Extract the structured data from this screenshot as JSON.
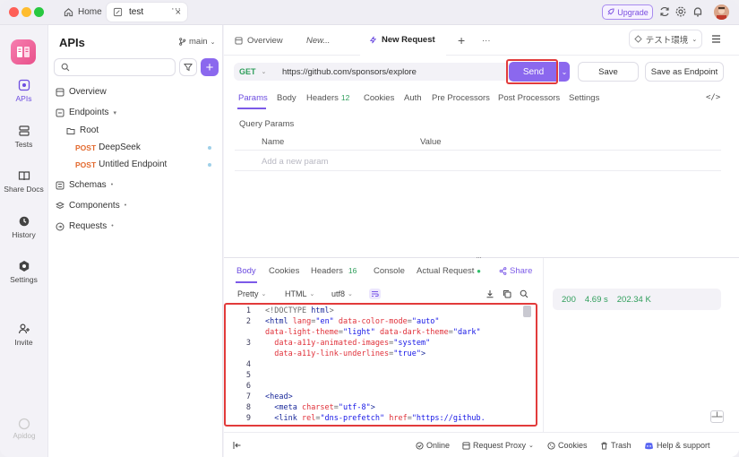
{
  "titlebar": {
    "tabs": [
      {
        "label": "Home"
      },
      {
        "label": "test"
      }
    ],
    "more": "···",
    "upgrade_label": "Upgrade"
  },
  "rail": {
    "items": [
      {
        "label": "APIs"
      },
      {
        "label": "Tests"
      },
      {
        "label": "Share Docs"
      },
      {
        "label": "History"
      },
      {
        "label": "Settings"
      },
      {
        "label": "Invite"
      }
    ],
    "footer": "Apidog"
  },
  "sidebar": {
    "title": "APIs",
    "branch": "main",
    "search_placeholder": "",
    "tree": {
      "overview": "Overview",
      "endpoints": "Endpoints",
      "root": "Root",
      "endpoints_list": [
        {
          "method": "POST",
          "name": "DeepSeek"
        },
        {
          "method": "POST",
          "name": "Untitled Endpoint"
        }
      ],
      "schemas": "Schemas",
      "components": "Components",
      "requests": "Requests"
    }
  },
  "request_tabs": {
    "tabs": [
      {
        "label": "Overview"
      },
      {
        "label": "New..."
      },
      {
        "label": "New Request"
      }
    ],
    "add": "+",
    "more": "···",
    "environment": "テスト環境"
  },
  "request": {
    "method": "GET",
    "url": "https://github.com/sponsors/explore",
    "send_label": "Send",
    "save_label": "Save",
    "save_endpoint_label": "Save as Endpoint",
    "method_color": "#2f9e5b",
    "accent": "#8b68ee"
  },
  "param_tabs": {
    "tabs": [
      {
        "label": "Params"
      },
      {
        "label": "Body"
      },
      {
        "label": "Headers",
        "count": "12"
      },
      {
        "label": "Cookies"
      },
      {
        "label": "Auth"
      },
      {
        "label": "Pre Processors"
      },
      {
        "label": "Post Processors"
      },
      {
        "label": "Settings"
      }
    ],
    "active": "Params",
    "code_icon": "</>"
  },
  "query_params": {
    "title": "Query Params",
    "columns": [
      "Name",
      "Value"
    ],
    "add_placeholder": "Add a new param"
  },
  "response": {
    "grip": "···",
    "tabs": [
      {
        "label": "Body"
      },
      {
        "label": "Cookies"
      },
      {
        "label": "Headers",
        "count": "16"
      },
      {
        "label": "Console"
      },
      {
        "label": "Actual Request"
      }
    ],
    "share_label": "Share",
    "format": {
      "view": "Pretty",
      "language": "HTML",
      "encoding": "utf8"
    },
    "stats": {
      "status": "200",
      "time": "4.69 s",
      "size": "202.34 K"
    },
    "lines": [
      {
        "num": "1",
        "segments": [
          {
            "t": "<!DOCTYPE ",
            "c": "cm"
          },
          {
            "t": "html",
            "c": "tag"
          },
          {
            "t": ">",
            "c": "cm"
          }
        ]
      },
      {
        "num": "2",
        "segments": [
          {
            "t": "<html ",
            "c": "tag"
          },
          {
            "t": "lang",
            "c": "at"
          },
          {
            "t": "=",
            "c": "cm"
          },
          {
            "t": "\"en\"",
            "c": "vl"
          },
          {
            "t": " data-color-mode",
            "c": "at"
          },
          {
            "t": "=",
            "c": "cm"
          },
          {
            "t": "\"auto\"",
            "c": "vl"
          }
        ]
      },
      {
        "num": "",
        "segments": [
          {
            "t": "data-light-theme",
            "c": "at"
          },
          {
            "t": "=",
            "c": "cm"
          },
          {
            "t": "\"light\"",
            "c": "vl"
          },
          {
            "t": " data-dark-theme",
            "c": "at"
          },
          {
            "t": "=",
            "c": "cm"
          },
          {
            "t": "\"dark\"",
            "c": "vl"
          }
        ]
      },
      {
        "num": "3",
        "segments": [
          {
            "t": "  data-a11y-animated-images",
            "c": "at"
          },
          {
            "t": "=",
            "c": "cm"
          },
          {
            "t": "\"system\"",
            "c": "vl"
          }
        ]
      },
      {
        "num": "",
        "segments": [
          {
            "t": "  data-a11y-link-underlines",
            "c": "at"
          },
          {
            "t": "=",
            "c": "cm"
          },
          {
            "t": "\"true\"",
            "c": "vl"
          },
          {
            "t": ">",
            "c": "tag"
          }
        ]
      },
      {
        "num": "4",
        "segments": []
      },
      {
        "num": "5",
        "segments": []
      },
      {
        "num": "6",
        "segments": []
      },
      {
        "num": "7",
        "segments": [
          {
            "t": "<head>",
            "c": "tag"
          }
        ]
      },
      {
        "num": "8",
        "segments": [
          {
            "t": "  <meta ",
            "c": "tag"
          },
          {
            "t": "charset",
            "c": "at"
          },
          {
            "t": "=",
            "c": "cm"
          },
          {
            "t": "\"utf-8\"",
            "c": "vl"
          },
          {
            "t": ">",
            "c": "tag"
          }
        ]
      },
      {
        "num": "9",
        "segments": [
          {
            "t": "  <link ",
            "c": "tag"
          },
          {
            "t": "rel",
            "c": "at"
          },
          {
            "t": "=",
            "c": "cm"
          },
          {
            "t": "\"dns-prefetch\"",
            "c": "vl"
          },
          {
            "t": " href",
            "c": "at"
          },
          {
            "t": "=",
            "c": "cm"
          },
          {
            "t": "\"https://github.",
            "c": "vl"
          }
        ]
      }
    ]
  },
  "statusbar": {
    "online": "Online",
    "proxy": "Request Proxy",
    "cookies": "Cookies",
    "trash": "Trash",
    "help": "Help & support"
  }
}
